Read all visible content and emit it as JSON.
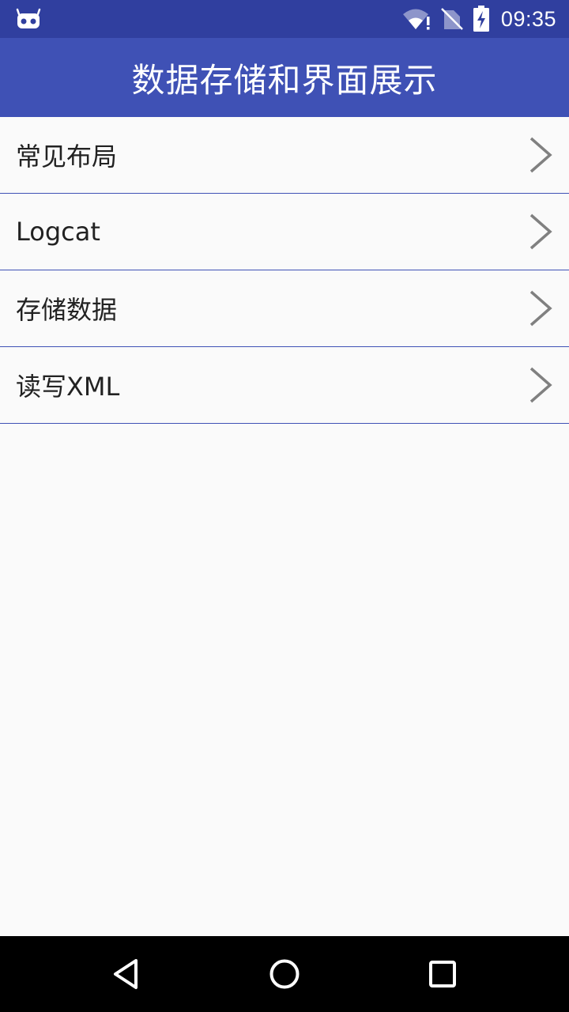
{
  "status_bar": {
    "time": "09:35",
    "icons": [
      "android-debug-icon",
      "wifi-alert-icon",
      "no-sim-icon",
      "battery-charging-icon"
    ]
  },
  "app_bar": {
    "title": "数据存储和界面展示"
  },
  "menu": {
    "items": [
      {
        "label": "常见布局"
      },
      {
        "label": "Logcat"
      },
      {
        "label": "存储数据"
      },
      {
        "label": "读写XML"
      }
    ]
  },
  "nav_bar": {
    "icons": [
      "back-icon",
      "home-icon",
      "recents-icon"
    ]
  },
  "colors": {
    "status_bar": "#303f9f",
    "app_bar": "#3f51b5",
    "divider": "#3f51b5",
    "background": "#fafafa",
    "nav_bar": "#000000"
  }
}
